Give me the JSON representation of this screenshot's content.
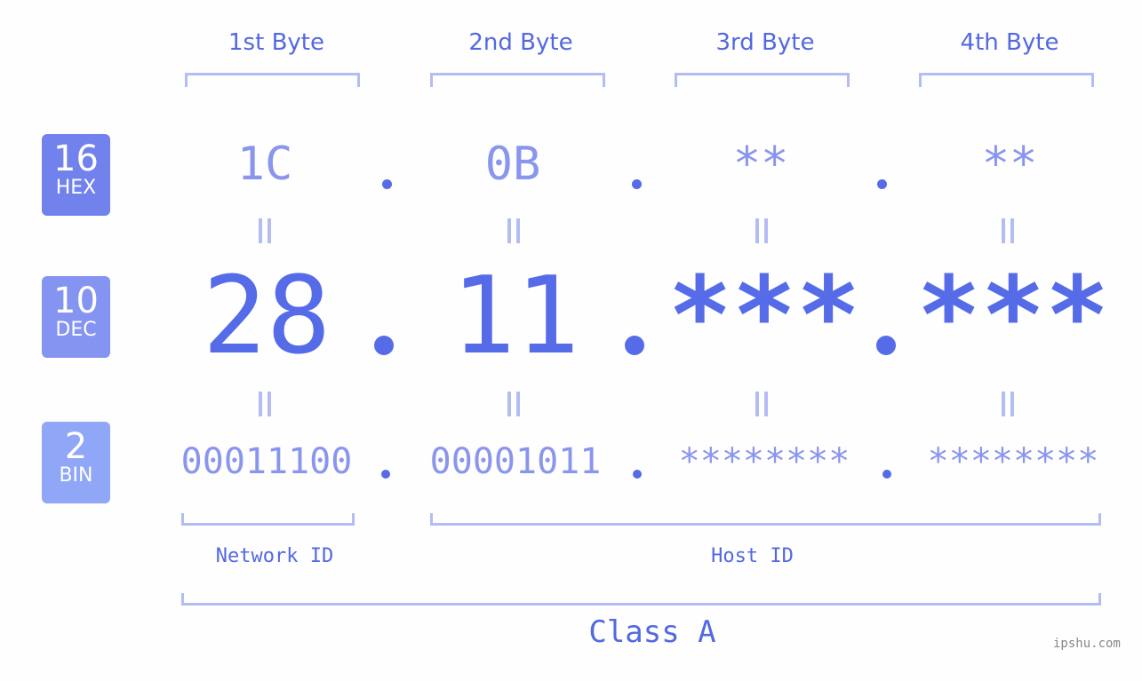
{
  "headers": [
    "1st Byte",
    "2nd Byte",
    "3rd Byte",
    "4th Byte"
  ],
  "badges": [
    {
      "number": "16",
      "label": "HEX",
      "color": "#7282ec"
    },
    {
      "number": "10",
      "label": "DEC",
      "color": "#8494f0"
    },
    {
      "number": "2",
      "label": "BIN",
      "color": "#90a6f7"
    }
  ],
  "hex": [
    "1C",
    "0B",
    "**",
    "**"
  ],
  "dec": [
    "28",
    "11",
    "***",
    "***"
  ],
  "bin": [
    "00011100",
    "00001011",
    "********",
    "********"
  ],
  "separator": ".",
  "equals": "=",
  "network_label": "Network ID",
  "host_label": "Host ID",
  "class_label": "Class A",
  "watermark": "ipshu.com"
}
